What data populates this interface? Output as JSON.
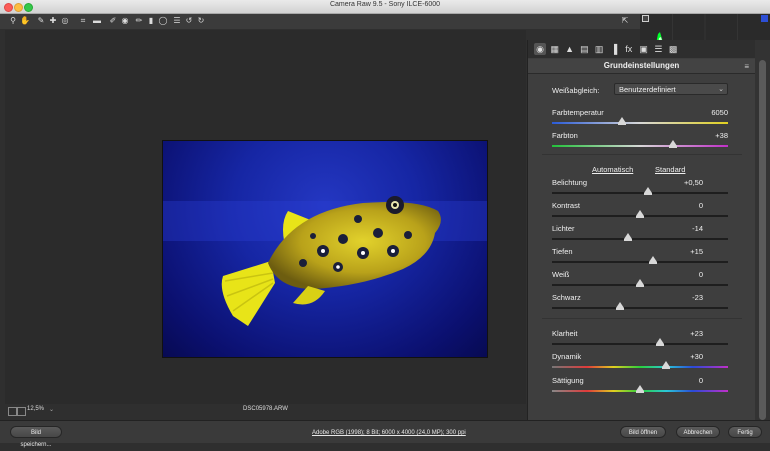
{
  "window": {
    "title": "Camera Raw 9.5 - Sony ILCE-6000"
  },
  "toolbar": {
    "tools": [
      "zoom-icon",
      "hand-icon",
      "white-balance-icon",
      "color-sampler-icon",
      "targeted-adjustment-icon",
      "crop-icon",
      "straighten-icon",
      "spot-removal-icon",
      "red-eye-icon",
      "adjustment-brush-icon",
      "graduated-filter-icon",
      "radial-filter-icon",
      "preferences-icon",
      "rotate-left-icon",
      "rotate-right-icon"
    ],
    "tool_glyphs": [
      "⚲",
      "✋",
      "✎",
      "✚",
      "◎",
      "⌗",
      "▬",
      "✐",
      "◉",
      "✏",
      "▮",
      "◯",
      "☰",
      "↺",
      "↻"
    ],
    "export_glyph": "⇱"
  },
  "panel": {
    "tab_glyphs": [
      "◉",
      "▦",
      "▲",
      "▤",
      "▥",
      "▐",
      "fx",
      "▣",
      "☰",
      "▩"
    ],
    "title": "Grundeinstellungen",
    "menu_glyph": "≡",
    "white_balance": {
      "label": "Weißabgleich:",
      "value": "Benutzerdefiniert"
    },
    "auto_label": "Automatisch",
    "default_label": "Standard",
    "sliders": [
      {
        "label": "Farbtemperatur",
        "value": "6050",
        "fraction": 0.4
      },
      {
        "label": "Farbton",
        "value": "+38",
        "fraction": 0.69
      },
      {
        "label": "Belichtung",
        "value": "+0,50",
        "fraction": 0.545
      },
      {
        "label": "Kontrast",
        "value": "0",
        "fraction": 0.5
      },
      {
        "label": "Lichter",
        "value": "-14",
        "fraction": 0.43
      },
      {
        "label": "Tiefen",
        "value": "+15",
        "fraction": 0.575
      },
      {
        "label": "Weiß",
        "value": "0",
        "fraction": 0.5
      },
      {
        "label": "Schwarz",
        "value": "-23",
        "fraction": 0.385
      },
      {
        "label": "Klarheit",
        "value": "+23",
        "fraction": 0.615
      },
      {
        "label": "Dynamik",
        "value": "+30",
        "fraction": 0.65
      },
      {
        "label": "Sättigung",
        "value": "0",
        "fraction": 0.5
      }
    ]
  },
  "status": {
    "zoom": "12,5%",
    "filename": "DSC05978.ARW"
  },
  "bottom": {
    "save_label": "Bild speichern...",
    "workflow": "Adobe RGB (1998); 8 Bit; 6000 x 4000 (24,0 MP); 300 ppi",
    "open_label": "Bild öffnen",
    "cancel_label": "Abbrechen",
    "done_label": "Fertig"
  },
  "colors": {
    "accent_green": "#00ff2a",
    "clip_blue": "#2d4fd6"
  }
}
